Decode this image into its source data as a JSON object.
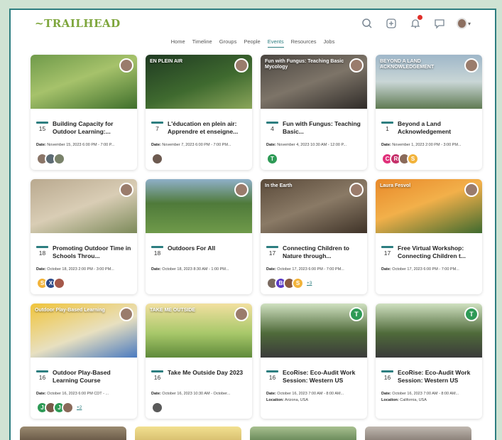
{
  "app": {
    "logo": "~TRAILHEAD"
  },
  "nav": [
    {
      "label": "Home",
      "active": false
    },
    {
      "label": "Timeline",
      "active": false
    },
    {
      "label": "Groups",
      "active": false
    },
    {
      "label": "People",
      "active": false
    },
    {
      "label": "Events",
      "active": true
    },
    {
      "label": "Resources",
      "active": false
    },
    {
      "label": "Jobs",
      "active": false
    }
  ],
  "toolbar": {
    "icons": [
      "search-icon",
      "compose-icon",
      "bell-icon",
      "chat-icon",
      "avatar"
    ],
    "notification_color": "#e0302a"
  },
  "colors": {
    "accent": "#2d7e80",
    "frame_bg": "#cfe3d3",
    "logo": "#7ea63c"
  },
  "cards": [
    {
      "day": "15",
      "title": "Building Capacity for Outdoor Learning:...",
      "date_label": "Date:",
      "date": "November 15, 2023 6:00 PM - 7:00 P...",
      "location": "",
      "thumb_text": "",
      "thumb": "linear-gradient(160deg,#6f9a4a 0%,#a6c26b 45%,#3f6f2b 100%)",
      "host": "",
      "attendees": [
        {
          "letter": "",
          "color": "#8a7568"
        },
        {
          "letter": "",
          "color": "#5d6b74"
        },
        {
          "letter": "",
          "color": "#79826a"
        }
      ],
      "more": ""
    },
    {
      "day": "7",
      "title": "L'éducation en plein air: Apprendre et enseigne...",
      "date_label": "Date:",
      "date": "November 7, 2023 6:00 PM - 7:00 PM...",
      "location": "",
      "thumb_text": "EN PLEIN AIR",
      "thumb": "linear-gradient(160deg,#1f3a22 0%,#3f6a2f 55%,#8aa55a 100%)",
      "host": "",
      "attendees": [
        {
          "letter": "",
          "color": "#6d5a50"
        }
      ],
      "more": ""
    },
    {
      "day": "4",
      "title": "Fun with Fungus: Teaching Basic...",
      "date_label": "Date:",
      "date": "November 4, 2023 10:30 AM - 12:00 P...",
      "location": "",
      "thumb_text": "Fun with Fungus: Teaching Basic Mycology",
      "thumb": "linear-gradient(160deg,#4a4540 0%,#7d7468 50%,#2f2b28 100%)",
      "host": "",
      "attendees": [
        {
          "letter": "T",
          "color": "#2e9a56"
        }
      ],
      "more": ""
    },
    {
      "day": "1",
      "title": "Beyond a Land Acknowledgement",
      "date_label": "Date:",
      "date": "November 1, 2023 2:00 PM - 3:00 PM...",
      "location": "",
      "thumb_text": "BEYOND A LAND ACKNOWLEDGEMENT",
      "thumb": "linear-gradient(180deg,#9fb7c9 0%,#c9d6d6 50%,#5f7a52 100%)",
      "host": "",
      "attendees": [
        {
          "letter": "C",
          "color": "#e0307a"
        },
        {
          "letter": "R",
          "color": "#c5306a"
        },
        {
          "letter": "",
          "color": "#8a6a5a"
        },
        {
          "letter": "S",
          "color": "#f2b33a"
        }
      ],
      "more": ""
    },
    {
      "day": "18",
      "title": "Promoting Outdoor Time in Schools Throu...",
      "date_label": "Date:",
      "date": "October 18, 2023 2:00 PM - 3:00 PM...",
      "location": "",
      "thumb_text": "",
      "thumb": "linear-gradient(160deg,#b9a98f 0%,#d9cdb5 50%,#7c8a5a 100%)",
      "host": "",
      "attendees": [
        {
          "letter": "S",
          "color": "#f2b33a"
        },
        {
          "letter": "X",
          "color": "#2d4a8a"
        },
        {
          "letter": "",
          "color": "#a5584a"
        }
      ],
      "more": ""
    },
    {
      "day": "18",
      "title": "Outdoors For All",
      "date_label": "Date:",
      "date": "October 18, 2023 8:30 AM - 1:00 PM...",
      "location": "",
      "thumb_text": "",
      "thumb": "linear-gradient(180deg,#8fb0c9 0%,#4f7a3a 45%,#6f9a4a 100%)",
      "host": "",
      "attendees": [],
      "more": ""
    },
    {
      "day": "17",
      "title": "Connecting Children to Nature through...",
      "date_label": "Date:",
      "date": "October 17, 2023 6:00 PM - 7:00 PM...",
      "location": "",
      "thumb_text": "In the Earth",
      "thumb": "linear-gradient(160deg,#5a4a3a 0%,#8a7a66 50%,#3f3328 100%)",
      "host": "",
      "attendees": [
        {
          "letter": "",
          "color": "#7a6a60"
        },
        {
          "letter": "B",
          "color": "#5a3ac5"
        },
        {
          "letter": "",
          "color": "#8a5a40"
        },
        {
          "letter": "S",
          "color": "#f2b33a"
        }
      ],
      "more": "+3"
    },
    {
      "day": "17",
      "title": "Free Virtual Workshop: Connecting Children t...",
      "date_label": "Date:",
      "date": "October 17, 2023 6:00 PM - 7:00 PM...",
      "location": "",
      "thumb_text": "Laura Fesvol",
      "thumb": "linear-gradient(160deg,#e8892a 0%,#f2b04a 45%,#3f6a2f 100%)",
      "host": "",
      "attendees": [],
      "more": ""
    },
    {
      "day": "16",
      "title": "Outdoor Play-Based Learning Course",
      "date_label": "Date:",
      "date": "October 16, 2023 6:00 PM CDT - ...",
      "location": "",
      "thumb_text": "Outdoor Play-Based Learning",
      "thumb": "linear-gradient(160deg,#f0c43a 0%,#e8e0c0 55%,#4a7ac0 100%)",
      "host": "",
      "attendees": [
        {
          "letter": "J",
          "color": "#2e9a56"
        },
        {
          "letter": "",
          "color": "#7a5a4a"
        },
        {
          "letter": "J",
          "color": "#2e9a56"
        },
        {
          "letter": "",
          "color": "#8a6a5a"
        }
      ],
      "more": "+2"
    },
    {
      "day": "16",
      "title": "Take Me Outside Day 2023",
      "date_label": "Date:",
      "date": "October 16, 2023 10:30 AM - October...",
      "location": "",
      "thumb_text": "TAKE ME OUTSIDE",
      "thumb": "linear-gradient(180deg,#f2e0a0 0%,#a8c86a 55%,#5f8a3a 100%)",
      "host": "",
      "attendees": [
        {
          "letter": "",
          "color": "#5a5a5a"
        }
      ],
      "more": ""
    },
    {
      "day": "16",
      "title": "EcoRise: Eco-Audit Work Session: Western US",
      "date_label": "Date:",
      "date": "October 16, 2023 7:00 AM - 8:00 AM...",
      "location_label": "Location:",
      "location": "Arizona, USA",
      "thumb_text": "",
      "thumb": "linear-gradient(180deg,#cfe0c0 0%,#4f6a3a 55%,#3a3a3a 100%)",
      "host": "T",
      "attendees": [],
      "more": ""
    },
    {
      "day": "16",
      "title": "EcoRise: Eco-Audit Work Session: Western US",
      "date_label": "Date:",
      "date": "October 16, 2023 7:00 AM - 8:00 AM...",
      "location_label": "Location:",
      "location": "California, USA",
      "thumb_text": "",
      "thumb": "linear-gradient(180deg,#cfe0c0 0%,#4f6a3a 55%,#3a3a3a 100%)",
      "host": "T",
      "attendees": [],
      "more": ""
    }
  ],
  "peek_row": [
    {
      "thumb": "linear-gradient(180deg,#9a8a70,#6a5a48)"
    },
    {
      "thumb": "linear-gradient(180deg,#f2e090,#d8c070)"
    },
    {
      "thumb": "linear-gradient(180deg,#a8c090,#6a8a5a)"
    },
    {
      "thumb": "linear-gradient(180deg,#c0b8b0,#8a8078)"
    }
  ]
}
